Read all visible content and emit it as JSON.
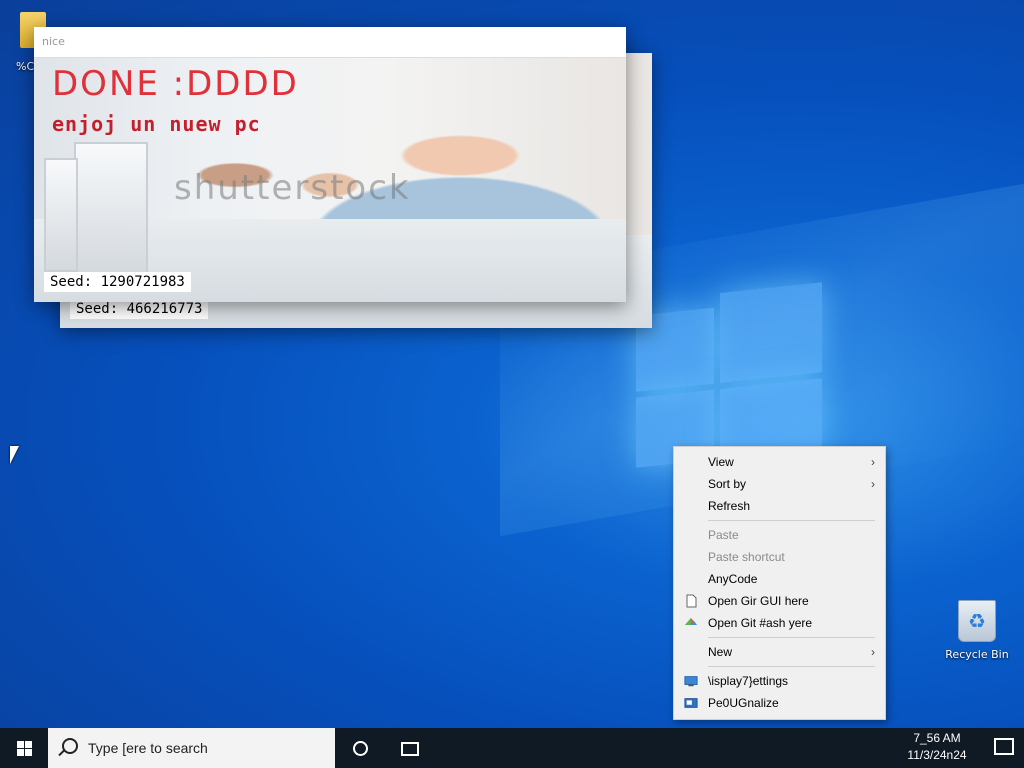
{
  "desktop": {
    "folder_label": "%C",
    "recycle_bin_label": "Recycle Bin"
  },
  "window_back": {
    "seed_label": "Seed: 466216773"
  },
  "window_front": {
    "title": "nice",
    "headline": "DONE :DDDD",
    "subline": "enjoj un nuew pc",
    "watermark": "shutterstock",
    "seed_label": "Seed: 1290721983"
  },
  "context_menu": {
    "items": [
      {
        "label": "View",
        "has_submenu": true,
        "enabled": true
      },
      {
        "label": "Sort by",
        "has_submenu": true,
        "enabled": true
      },
      {
        "label": "Refresh",
        "has_submenu": false,
        "enabled": true
      },
      {
        "label": "Paste",
        "has_submenu": false,
        "enabled": false
      },
      {
        "label": "Paste shortcut",
        "has_submenu": false,
        "enabled": false
      },
      {
        "label": "AnyCode",
        "has_submenu": false,
        "enabled": true
      },
      {
        "label": "Open Gir GUI here",
        "has_submenu": false,
        "enabled": true,
        "icon": "file-icon"
      },
      {
        "label": "Open Git #ash yere",
        "has_submenu": false,
        "enabled": true,
        "icon": "git-icon"
      },
      {
        "label": "New",
        "has_submenu": true,
        "enabled": true
      },
      {
        "label": "\\isplay7}ettings",
        "has_submenu": false,
        "enabled": true,
        "icon": "display-icon"
      },
      {
        "label": "Pe0UGnalize",
        "has_submenu": false,
        "enabled": true,
        "icon": "personalize-icon"
      }
    ],
    "submenu_arrow": "›"
  },
  "taskbar": {
    "search_placeholder": "Type [ere to search",
    "time": "7_56 AM",
    "date": "11/3/24n24"
  },
  "colors": {
    "desktop_accent": "#0b63cf",
    "taskbar_bg": "#101a24",
    "menu_bg": "#f0f0f0",
    "headline_red": "#e0303a"
  }
}
